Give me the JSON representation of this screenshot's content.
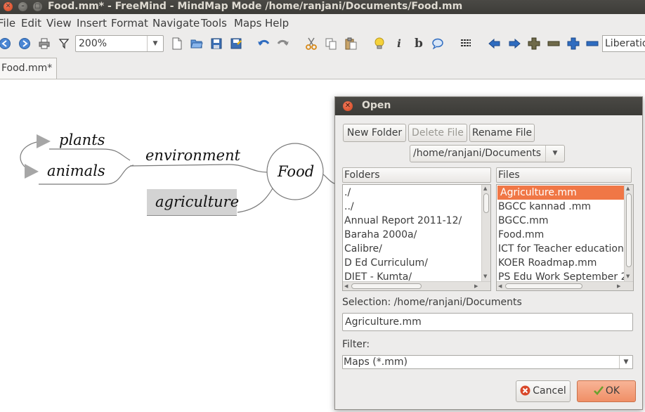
{
  "window": {
    "title": "Food.mm* - FreeMind - MindMap Mode /home/ranjani/Documents/Food.mm"
  },
  "menubar": {
    "items": [
      "File",
      "Edit",
      "View",
      "Insert",
      "Format",
      "Navigate",
      "Tools",
      "Maps",
      "Help"
    ]
  },
  "toolbar": {
    "zoom_value": "200%",
    "font_value": "Liberation Sans"
  },
  "tabs": {
    "active_label": "Food.mm*"
  },
  "mindmap": {
    "root": "Food",
    "nodes": {
      "plants": "plants",
      "animals": "animals",
      "environment": "environment",
      "agriculture": "agriculture"
    }
  },
  "dialog": {
    "title": "Open",
    "new_folder": "New Folder",
    "delete_file": "Delete File",
    "rename_file": "Rename File",
    "path": "/home/ranjani/Documents",
    "folders_header": "Folders",
    "files_header": "Files",
    "folders": [
      "./",
      "../",
      "Annual Report 2011-12/",
      "Baraha 2000a/",
      "Calibre/",
      "D Ed Curriculum/",
      "DIET - Kumta/"
    ],
    "files": [
      "Agriculture.mm",
      "BGCC kannad .mm",
      "BGCC.mm",
      "Food.mm",
      "ICT for Teacher education",
      "KOER Roadmap.mm",
      "PS Edu Work September 2"
    ],
    "selected_file": "Agriculture.mm",
    "selection_label": "Selection: /home/ranjani/Documents",
    "selection_value": "Agriculture.mm",
    "filter_label": "Filter:",
    "filter_value": "Maps (*.mm)",
    "cancel": "Cancel",
    "ok": "OK"
  },
  "colors": {
    "selection": "#f07746",
    "titlebar": "#3c3b37",
    "window_bg": "#edeceb",
    "ok_button": "#f5a27f"
  }
}
